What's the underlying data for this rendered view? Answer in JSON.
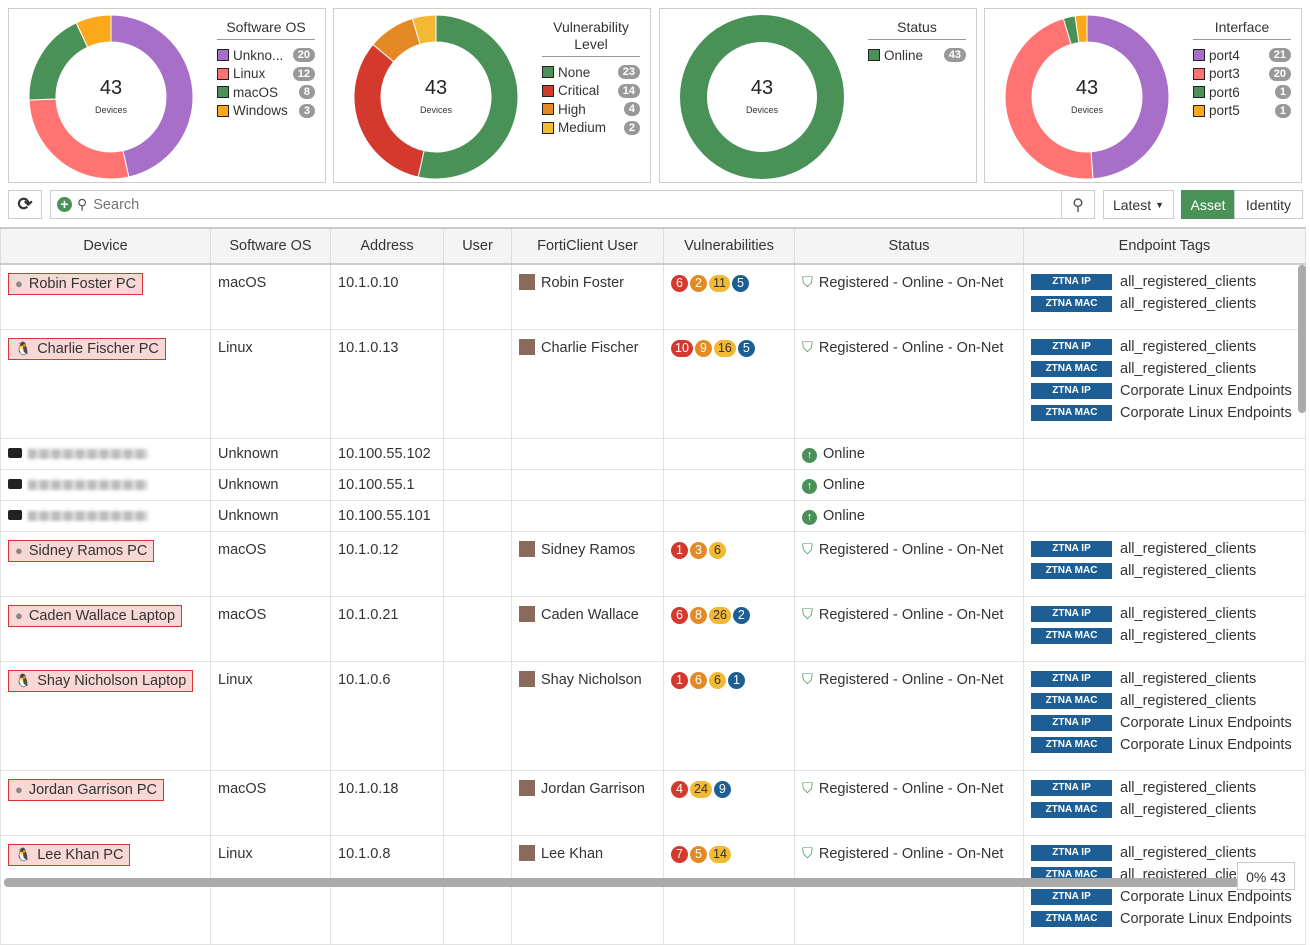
{
  "center_label": "Devices",
  "charts": [
    {
      "title": "Software OS",
      "total": "43",
      "items": [
        {
          "label": "Unkno...",
          "value": 20,
          "color": "#a86fc8"
        },
        {
          "label": "Linux",
          "value": 12,
          "color": "#ff7373"
        },
        {
          "label": "macOS",
          "value": 8,
          "color": "#4a9158"
        },
        {
          "label": "Windows",
          "value": 3,
          "color": "#fba81b"
        }
      ]
    },
    {
      "title": "Vulnerability Level",
      "total": "43",
      "items": [
        {
          "label": "None",
          "value": 23,
          "color": "#4a9158"
        },
        {
          "label": "Critical",
          "value": 14,
          "color": "#d3392c"
        },
        {
          "label": "High",
          "value": 4,
          "color": "#e38a25"
        },
        {
          "label": "Medium",
          "value": 2,
          "color": "#f3b834"
        }
      ]
    },
    {
      "title": "Status",
      "total": "43",
      "items": [
        {
          "label": "Online",
          "value": 43,
          "color": "#4a9158"
        }
      ]
    },
    {
      "title": "Interface",
      "total": "43",
      "items": [
        {
          "label": "port4",
          "value": 21,
          "color": "#a86fc8"
        },
        {
          "label": "port3",
          "value": 20,
          "color": "#ff7373"
        },
        {
          "label": "port6",
          "value": 1,
          "color": "#4a9158"
        },
        {
          "label": "port5",
          "value": 1,
          "color": "#fba81b"
        }
      ]
    }
  ],
  "toolbar": {
    "search_placeholder": "Search",
    "latest": "Latest",
    "asset": "Asset",
    "identity": "Identity"
  },
  "columns": [
    "Device",
    "Software OS",
    "Address",
    "User",
    "FortiClient User",
    "Vulnerabilities",
    "Status",
    "Endpoint Tags"
  ],
  "vuln_colors": {
    "critical": "#d3392c",
    "high": "#e38a25",
    "medium": "#f3b834",
    "low": "#1d5e94"
  },
  "rows": [
    {
      "device": "Robin Foster PC",
      "icon": "apple",
      "os": "macOS",
      "address": "10.1.0.10",
      "fc_user": "Robin Foster",
      "vulns": [
        [
          "critical",
          6
        ],
        [
          "high",
          2
        ],
        [
          "medium",
          11
        ],
        [
          "low",
          5
        ]
      ],
      "status": "Registered - Online - On-Net",
      "tags": [
        [
          "ZTNA IP",
          "all_registered_clients"
        ],
        [
          "ZTNA MAC",
          "all_registered_clients"
        ]
      ]
    },
    {
      "device": "Charlie Fischer PC",
      "icon": "linux",
      "os": "Linux",
      "address": "10.1.0.13",
      "fc_user": "Charlie Fischer",
      "vulns": [
        [
          "critical",
          10
        ],
        [
          "high",
          9
        ],
        [
          "medium",
          16
        ],
        [
          "low",
          5
        ]
      ],
      "status": "Registered - Online - On-Net",
      "tags": [
        [
          "ZTNA IP",
          "all_registered_clients"
        ],
        [
          "ZTNA MAC",
          "all_registered_clients"
        ],
        [
          "ZTNA IP",
          "Corporate Linux Endpoints"
        ],
        [
          "ZTNA MAC",
          "Corporate Linux Endpoints"
        ]
      ]
    },
    {
      "device": "",
      "icon": "device",
      "os": "Unknown",
      "address": "10.100.55.102",
      "fc_user": "",
      "vulns": [],
      "status": "Online",
      "tags": []
    },
    {
      "device": "",
      "icon": "device",
      "os": "Unknown",
      "address": "10.100.55.1",
      "fc_user": "",
      "vulns": [],
      "status": "Online",
      "tags": []
    },
    {
      "device": "",
      "icon": "device",
      "os": "Unknown",
      "address": "10.100.55.101",
      "fc_user": "",
      "vulns": [],
      "status": "Online",
      "tags": []
    },
    {
      "device": "Sidney Ramos PC",
      "icon": "apple",
      "os": "macOS",
      "address": "10.1.0.12",
      "fc_user": "Sidney Ramos",
      "vulns": [
        [
          "critical",
          1
        ],
        [
          "high",
          3
        ],
        [
          "medium",
          6
        ]
      ],
      "status": "Registered - Online - On-Net",
      "tags": [
        [
          "ZTNA IP",
          "all_registered_clients"
        ],
        [
          "ZTNA MAC",
          "all_registered_clients"
        ]
      ]
    },
    {
      "device": "Caden Wallace Laptop",
      "icon": "apple",
      "os": "macOS",
      "address": "10.1.0.21",
      "fc_user": "Caden Wallace",
      "vulns": [
        [
          "critical",
          6
        ],
        [
          "high",
          8
        ],
        [
          "medium",
          26
        ],
        [
          "low",
          2
        ]
      ],
      "status": "Registered - Online - On-Net",
      "tags": [
        [
          "ZTNA IP",
          "all_registered_clients"
        ],
        [
          "ZTNA MAC",
          "all_registered_clients"
        ]
      ]
    },
    {
      "device": "Shay Nicholson Laptop",
      "icon": "linux",
      "os": "Linux",
      "address": "10.1.0.6",
      "fc_user": "Shay Nicholson",
      "vulns": [
        [
          "critical",
          1
        ],
        [
          "high",
          6
        ],
        [
          "medium",
          6
        ],
        [
          "low",
          1
        ]
      ],
      "status": "Registered - Online - On-Net",
      "tags": [
        [
          "ZTNA IP",
          "all_registered_clients"
        ],
        [
          "ZTNA MAC",
          "all_registered_clients"
        ],
        [
          "ZTNA IP",
          "Corporate Linux Endpoints"
        ],
        [
          "ZTNA MAC",
          "Corporate Linux Endpoints"
        ]
      ]
    },
    {
      "device": "Jordan Garrison PC",
      "icon": "apple",
      "os": "macOS",
      "address": "10.1.0.18",
      "fc_user": "Jordan Garrison",
      "vulns": [
        [
          "critical",
          4
        ],
        [
          "medium",
          24
        ],
        [
          "low",
          9
        ]
      ],
      "status": "Registered - Online - On-Net",
      "tags": [
        [
          "ZTNA IP",
          "all_registered_clients"
        ],
        [
          "ZTNA MAC",
          "all_registered_clients"
        ]
      ]
    },
    {
      "device": "Lee Khan PC",
      "icon": "linux",
      "os": "Linux",
      "address": "10.1.0.8",
      "fc_user": "Lee Khan",
      "vulns": [
        [
          "critical",
          7
        ],
        [
          "high",
          5
        ],
        [
          "medium",
          14
        ]
      ],
      "status": "Registered - Online - On-Net",
      "tags": [
        [
          "ZTNA IP",
          "all_registered_clients"
        ],
        [
          "ZTNA MAC",
          "all_registered_clients"
        ],
        [
          "ZTNA IP",
          "Corporate Linux Endpoints"
        ],
        [
          "ZTNA MAC",
          "Corporate Linux Endpoints"
        ]
      ]
    }
  ],
  "footer": {
    "progress": "0% 43"
  }
}
